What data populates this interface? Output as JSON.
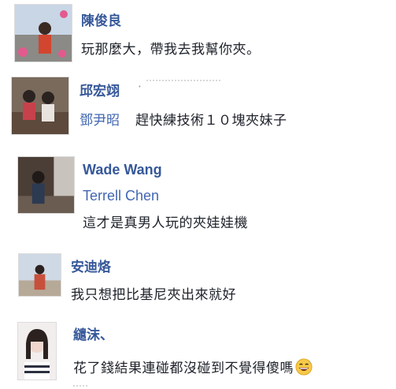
{
  "comments": [
    {
      "author": "陳俊良",
      "text": "玩那麼大，帶我去我幫你夾。"
    },
    {
      "author": "邱宏翊",
      "separator": "·",
      "mention": "鄧尹昭",
      "text": "趕快練技術１０塊夾妹子"
    },
    {
      "author": "Wade Wang",
      "mention": "Terrell Chen",
      "text": "這才是真男人玩的夾娃娃機"
    },
    {
      "author": "安迪烙",
      "text": "我只想把比基尼夾出來就好"
    },
    {
      "author": "繾沫、",
      "text": "花了錢結果連碰都沒碰到不覺得傻嗎",
      "emoji": "grinning-sweat-emoji"
    }
  ],
  "colors": {
    "author": "#365899",
    "mention": "#4267b2",
    "text": "#1d2129"
  }
}
